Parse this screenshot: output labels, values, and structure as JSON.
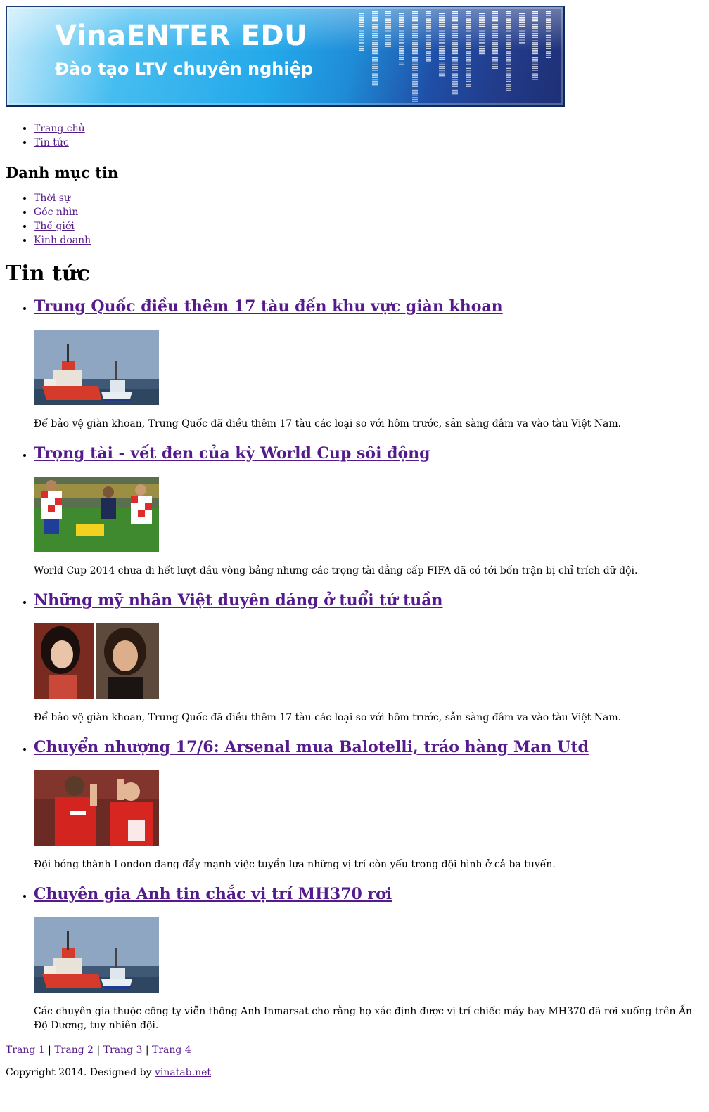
{
  "banner": {
    "brand": "VinaENTER EDU",
    "tagline": "Đào tạo LTV chuyên nghiệp",
    "colors": {
      "accent_light": "#46bdf0",
      "accent_dark": "#1e2f75"
    }
  },
  "nav": {
    "items": [
      {
        "label": "Trang chủ"
      },
      {
        "label": "Tin tức"
      }
    ]
  },
  "sidebar": {
    "title": "Danh mục tin",
    "categories": [
      {
        "label": "Thời sự"
      },
      {
        "label": "Góc nhìn"
      },
      {
        "label": "Thế giới"
      },
      {
        "label": "Kinh doanh"
      }
    ]
  },
  "main": {
    "title": "Tin tức",
    "articles": [
      {
        "title": "Trung Quốc điều thêm 17 tàu đến khu vực giàn khoan",
        "image": "ships-photo",
        "summary": "Để bảo vệ giàn khoan, Trung Quốc đã điều thêm 17 tàu các loại so với hôm trước, sẵn sàng đâm va vào tàu Việt Nam."
      },
      {
        "title": "Trọng tài - vết đen của kỳ World Cup sôi động",
        "image": "football-photo",
        "summary": "World Cup 2014 chưa đi hết lượt đầu vòng bảng nhưng các trọng tài đẳng cấp FIFA đã có tới bốn trận bị chỉ trích dữ dội."
      },
      {
        "title": "Những mỹ nhân Việt duyên dáng ở tuổi tứ tuần",
        "image": "portraits-photo",
        "summary": "Để bảo vệ giàn khoan, Trung Quốc đã điều thêm 17 tàu các loại so với hôm trước, sẵn sàng đâm va vào tàu Việt Nam."
      },
      {
        "title": "Chuyển nhượng 17/6: Arsenal mua Balotelli, tráo hàng Man Utd",
        "image": "players-photo",
        "summary": "Đội bóng thành London đang đẩy mạnh việc tuyển lựa những vị trí còn yếu trong đội hình ở cả ba tuyến."
      },
      {
        "title": "Chuyên gia Anh tin chắc vị trí MH370 rơi",
        "image": "ships-photo",
        "summary": "Các chuyên gia thuộc công ty viễn thông Anh Inmarsat cho rằng họ xác định được vị trí chiếc máy bay MH370 đã rơi xuống trên Ấn Độ Dương, tuy nhiên đội."
      }
    ]
  },
  "pagination": {
    "pages": [
      "Trang 1",
      "Trang 2",
      "Trang 3",
      "Trang 4"
    ],
    "separator": " | "
  },
  "footer": {
    "copyright": "Copyright 2014. Designed by ",
    "link": "vinatab.net"
  }
}
